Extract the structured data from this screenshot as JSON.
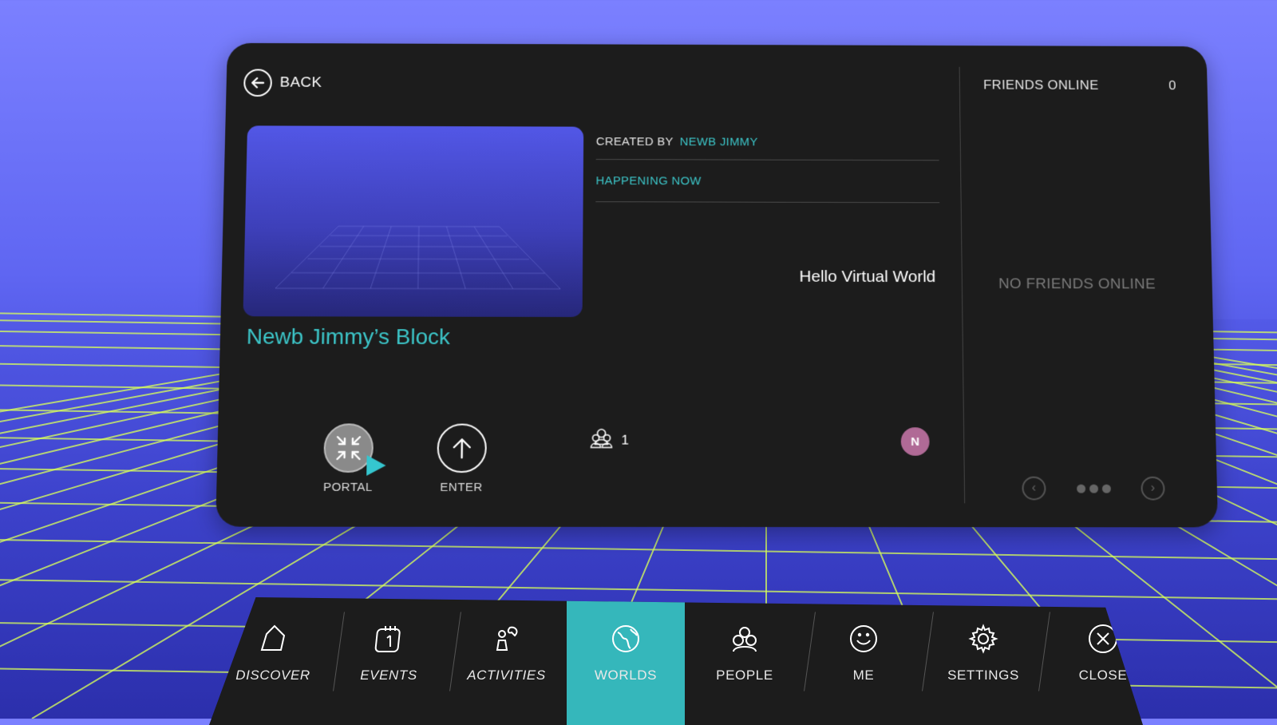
{
  "header": {
    "back_label": "BACK"
  },
  "world": {
    "title": "Newb Jimmy’s Block",
    "created_by_label": "CREATED BY",
    "created_by_value": "NEWB JIMMY",
    "status": "HAPPENING NOW",
    "description": "Hello Virtual World",
    "user_count": "1",
    "avatar_initial": "N"
  },
  "actions": {
    "portal_label": "PORTAL",
    "enter_label": "ENTER"
  },
  "friends": {
    "heading": "FRIENDS ONLINE",
    "count": "0",
    "empty_text": "NO FRIENDS ONLINE"
  },
  "nav": {
    "items": [
      {
        "label": "DISCOVER",
        "icon": "discover-icon"
      },
      {
        "label": "EVENTS",
        "icon": "calendar-icon"
      },
      {
        "label": "ACTIVITIES",
        "icon": "activities-icon"
      },
      {
        "label": "WORLDS",
        "icon": "globe-icon",
        "active": true
      },
      {
        "label": "PEOPLE",
        "icon": "people-icon"
      },
      {
        "label": "ME",
        "icon": "smiley-icon"
      },
      {
        "label": "SETTINGS",
        "icon": "gear-icon"
      },
      {
        "label": "CLOSE",
        "icon": "close-icon"
      }
    ]
  },
  "colors": {
    "accent": "#35b7bb",
    "panel": "#1c1c1c",
    "grid_line": "#d8ff5a",
    "sky_top": "#7b80ff",
    "avatar": "#b06a96"
  }
}
